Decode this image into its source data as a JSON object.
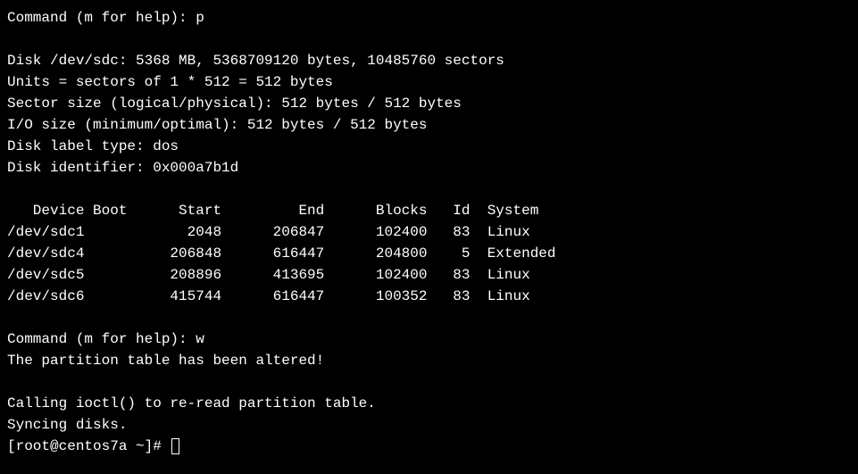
{
  "prompt1": "Command (m for help): p",
  "disk_line": "Disk /dev/sdc: 5368 MB, 5368709120 bytes, 10485760 sectors",
  "units_line": "Units = sectors of 1 * 512 = 512 bytes",
  "sector_size_line": "Sector size (logical/physical): 512 bytes / 512 bytes",
  "io_size_line": "I/O size (minimum/optimal): 512 bytes / 512 bytes",
  "label_type_line": "Disk label type: dos",
  "identifier_line": "Disk identifier: 0x000a7b1d",
  "table_header": "   Device Boot      Start         End      Blocks   Id  System",
  "table_rows": [
    "/dev/sdc1            2048      206847      102400   83  Linux",
    "/dev/sdc4          206848      616447      204800    5  Extended",
    "/dev/sdc5          208896      413695      102400   83  Linux",
    "/dev/sdc6          415744      616447      100352   83  Linux"
  ],
  "prompt2": "Command (m for help): w",
  "altered_line": "The partition table has been altered!",
  "ioctl_line": "Calling ioctl() to re-read partition table.",
  "syncing_line": "Syncing disks.",
  "shell_prompt": "[root@centos7a ~]# ",
  "chart_data": {
    "type": "table",
    "title": "fdisk partition table for /dev/sdc",
    "disk": "/dev/sdc",
    "size_mb": 5368,
    "size_bytes": 5368709120,
    "sectors": 10485760,
    "unit_bytes": 512,
    "sector_size_logical": 512,
    "sector_size_physical": 512,
    "io_size_min": 512,
    "io_size_optimal": 512,
    "label_type": "dos",
    "identifier": "0x000a7b1d",
    "columns": [
      "Device",
      "Boot",
      "Start",
      "End",
      "Blocks",
      "Id",
      "System"
    ],
    "rows": [
      {
        "Device": "/dev/sdc1",
        "Boot": "",
        "Start": 2048,
        "End": 206847,
        "Blocks": 102400,
        "Id": "83",
        "System": "Linux"
      },
      {
        "Device": "/dev/sdc4",
        "Boot": "",
        "Start": 206848,
        "End": 616447,
        "Blocks": 204800,
        "Id": "5",
        "System": "Extended"
      },
      {
        "Device": "/dev/sdc5",
        "Boot": "",
        "Start": 208896,
        "End": 413695,
        "Blocks": 102400,
        "Id": "83",
        "System": "Linux"
      },
      {
        "Device": "/dev/sdc6",
        "Boot": "",
        "Start": 415744,
        "End": 616447,
        "Blocks": 100352,
        "Id": "83",
        "System": "Linux"
      }
    ]
  }
}
